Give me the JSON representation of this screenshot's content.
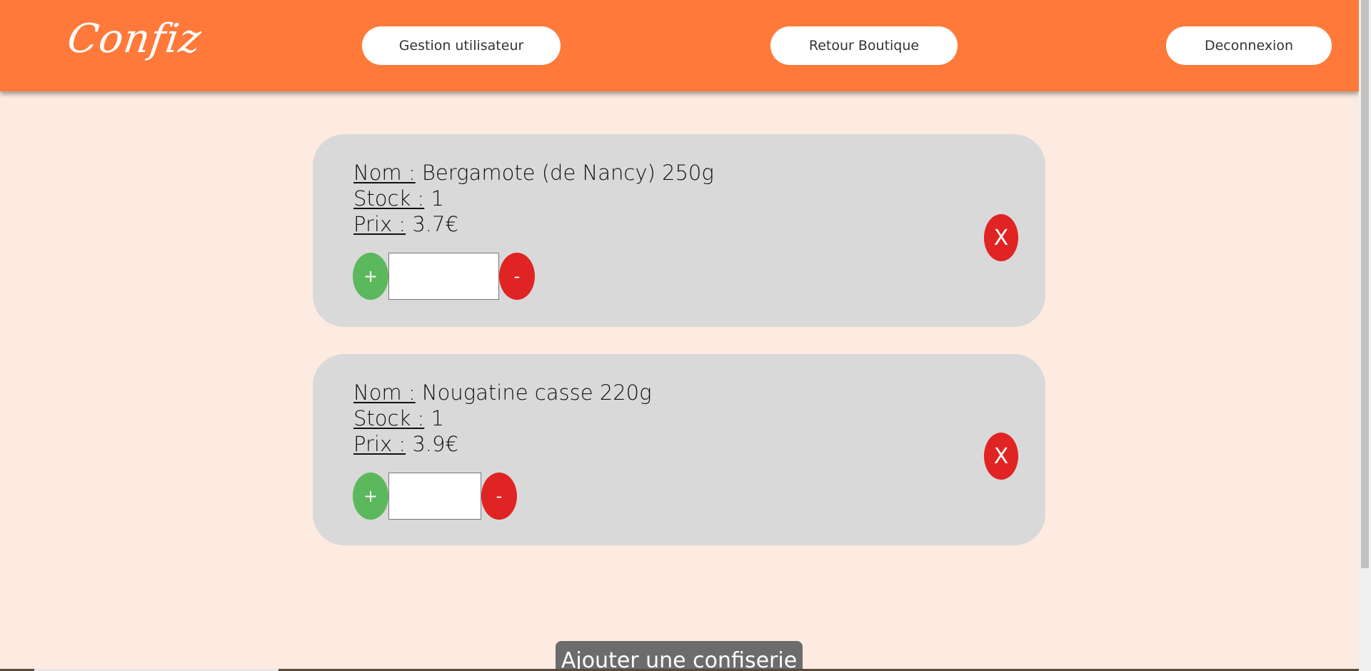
{
  "header": {
    "logo": "Confiz",
    "nav": {
      "users_label": "Gestion utilisateur",
      "shop_label": "Retour Boutique",
      "logout_label": "Deconnexion"
    }
  },
  "field_labels": {
    "name": "Nom :",
    "stock": "Stock :",
    "price": "Prix :"
  },
  "products": [
    {
      "name": "Bergamote (de Nancy) 250g",
      "stock": "1",
      "price": "3.7€"
    },
    {
      "name": "Nougatine casse 220g",
      "stock": "1",
      "price": "3.9€"
    }
  ],
  "controls": {
    "plus": "+",
    "minus": "-",
    "delete": "X",
    "qty_value": ""
  },
  "footer": {
    "add_label": "Ajouter une confiserie"
  },
  "colors": {
    "header": "#ff7a3a",
    "background": "#fdebe1",
    "card": "#d9d9d9",
    "plus": "#5cb85c",
    "minus_delete": "#e02424",
    "add_button": "#6c6c6c"
  }
}
